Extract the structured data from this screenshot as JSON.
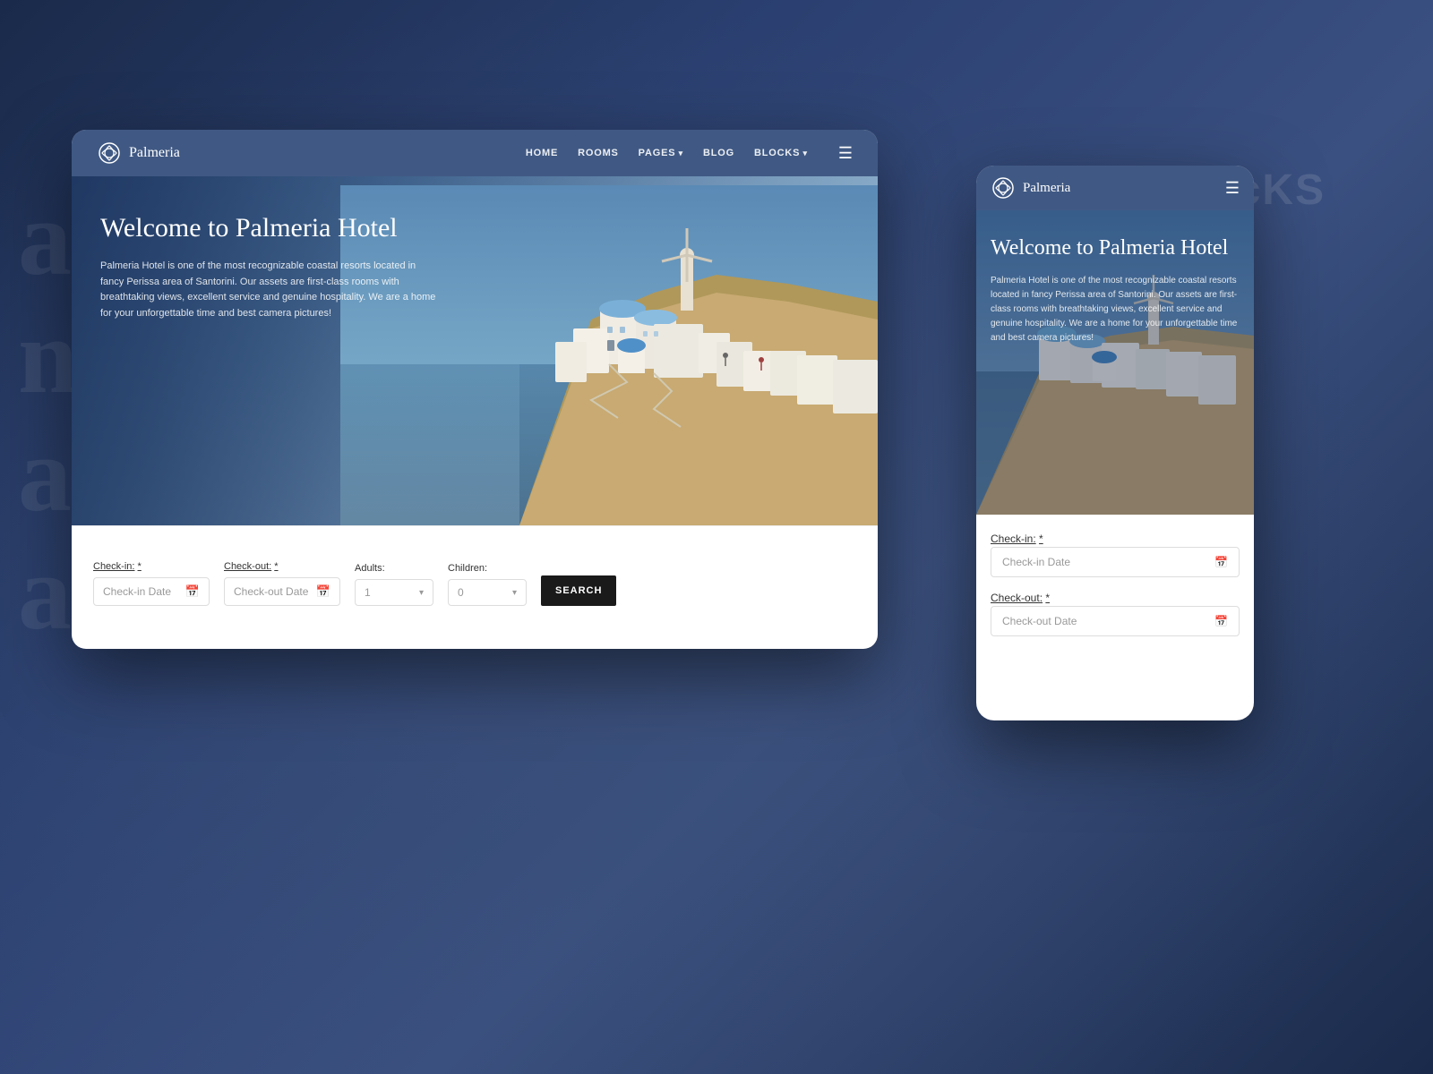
{
  "background": {
    "text_lines": [
      "alr",
      "ngn",
      "ans",
      "a h"
    ]
  },
  "blocks_label": "blocKS",
  "desktop": {
    "nav": {
      "logo_text": "Palmeria",
      "links": [
        {
          "label": "HOME",
          "has_arrow": false
        },
        {
          "label": "ROOMS",
          "has_arrow": false
        },
        {
          "label": "PAGES",
          "has_arrow": true
        },
        {
          "label": "BLOG",
          "has_arrow": false
        },
        {
          "label": "BLOCKS",
          "has_arrow": true
        }
      ]
    },
    "hero": {
      "title": "Welcome to Palmeria Hotel",
      "description": "Palmeria Hotel is one of the most recognizable coastal resorts located in fancy Perissa area of Santorini. Our assets are first-class rooms with breathtaking views, excellent service and genuine hospitality. We are a home for your unforgettable time and best camera pictures!"
    },
    "booking": {
      "checkin_label": "Check-in:",
      "checkin_required": "*",
      "checkin_placeholder": "Check-in Date",
      "checkout_label": "Check-out:",
      "checkout_required": "*",
      "checkout_placeholder": "Check-out Date",
      "adults_label": "Adults:",
      "adults_value": "1",
      "children_label": "Children:",
      "children_value": "0",
      "search_label": "SEARCH"
    }
  },
  "mobile": {
    "nav": {
      "logo_text": "Palmeria"
    },
    "hero": {
      "title": "Welcome to Palmeria Hotel",
      "description": "Palmeria Hotel is one of the most recognizable coastal resorts located in fancy Perissa area of Santorini. Our assets are first-class rooms with breathtaking views, excellent service and genuine hospitality. We are a home for your unforgettable time and best camera pictures!"
    },
    "booking": {
      "checkin_label": "Check-in:",
      "checkin_required": "*",
      "checkin_placeholder": "Check-in Date",
      "checkout_label": "Check-out:",
      "checkout_required": "*",
      "checkout_placeholder": "Check-out Date"
    }
  }
}
